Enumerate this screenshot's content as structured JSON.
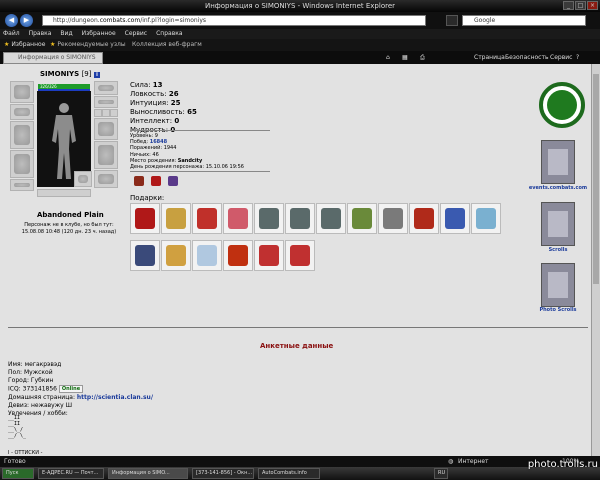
{
  "window": {
    "title": "Информация о SIMONIYS - Windows Internet Explorer",
    "minimize": "_",
    "maximize": "□",
    "close": "×"
  },
  "nav": {
    "back": "◀",
    "forward": "▶",
    "url_prefix": "http://dungeon.",
    "url_domain": "combats.com",
    "url_suffix": "/inf.pl?login=simoniys",
    "search_placeholder": "Google"
  },
  "menu": [
    "Файл",
    "Правка",
    "Вид",
    "Избранное",
    "Сервис",
    "Справка"
  ],
  "favorites": {
    "label": "Избранное",
    "links": [
      "Рекомендуемые узлы",
      "Коллекция веб-фрагм"
    ]
  },
  "tab": {
    "label": "Информация о SIMONIYS"
  },
  "commands": {
    "page": "Страница",
    "security": "Безопасность",
    "tools": "Сервис",
    "help": "?"
  },
  "character": {
    "nickname": "SIMONIYS",
    "level": "[9]",
    "info_icon": "i",
    "hp": "326/326",
    "location": "Abandoned Plain",
    "not_in_club": "Персонаж не в клубе, но был тут:",
    "last_seen": "15.08.08 10:48 (120 дн. 23 ч. назад)"
  },
  "stats": [
    {
      "label": "Сила:",
      "value": "13"
    },
    {
      "label": "Ловкость:",
      "value": "26"
    },
    {
      "label": "Интуиция:",
      "value": "25"
    },
    {
      "label": "Выносливость:",
      "value": "65"
    },
    {
      "label": "Интеллект:",
      "value": "0"
    },
    {
      "label": "Мудрость:",
      "value": "0"
    }
  ],
  "details": {
    "level_label": "Уровень:",
    "level_value": "9",
    "wins_label": "Побед:",
    "wins_value": "16848",
    "losses_label": "Поражений:",
    "losses_value": "1944",
    "draws_label": "Ничьих:",
    "draws_value": "46",
    "birthplace_label": "Место рождения:",
    "birthplace_value": "Sandcity",
    "birthday_label": "День рождения персонажа:",
    "birthday_value": "15.10.06 19:56"
  },
  "gifts": {
    "label": "Подарки:",
    "row1_colors": [
      "#b01818",
      "#c8a040",
      "#c0302a",
      "#d05a6a",
      "#5a6a6a",
      "#5a6a6a",
      "#5a6a6a",
      "#6a8a3a",
      "#7a7a7a",
      "#b02a1a",
      "#3a5ab0",
      "#7ab0d0"
    ],
    "row2_colors": [
      "#3a4a7a",
      "#d0a040",
      "#b0c8e0",
      "#c03010",
      "#c03030",
      "#c03030"
    ]
  },
  "sidebar": {
    "events_label": "events.combats.com",
    "scrolls_label": "Scrolls",
    "photo_scrolls_label": "Photo Scrolls"
  },
  "profile": {
    "heading": "Анкетные данные",
    "name_label": "Имя:",
    "name_value": "мегакрэвэд",
    "sex_label": "Пол:",
    "sex_value": "Мужской",
    "city_label": "Город:",
    "city_value": "Губкин",
    "icq_label": "ICQ:",
    "icq_value": "373141856",
    "online_badge": "Online",
    "homepage_label": "Домашняя страница:",
    "homepage_value": "http://scientia.clan.su/",
    "motto_label": "Девиз:",
    "motto_value": "нежавужу Ш",
    "hobby_label": "Увлечения / хобби:",
    "ascii": "__II\n__II\n__\\_/\n__/ \\_",
    "footnote": "I - ОТТИСКИ -"
  },
  "status": {
    "left": "Готово",
    "zone": "Интернет",
    "zoom": "100%"
  },
  "taskbar": {
    "start": "Пуск",
    "items": [
      "E-АДРЕС.RU — Почт...",
      "Информация о SIMO...",
      "[373-141-856] - Окн...",
      "AutoCombats.info"
    ],
    "lang": "RU"
  },
  "watermark": "photo.trolls.ru",
  "colors": {
    "hp": "#1e9b2a",
    "heading": "#8a1010",
    "link": "#1a3a9a"
  }
}
